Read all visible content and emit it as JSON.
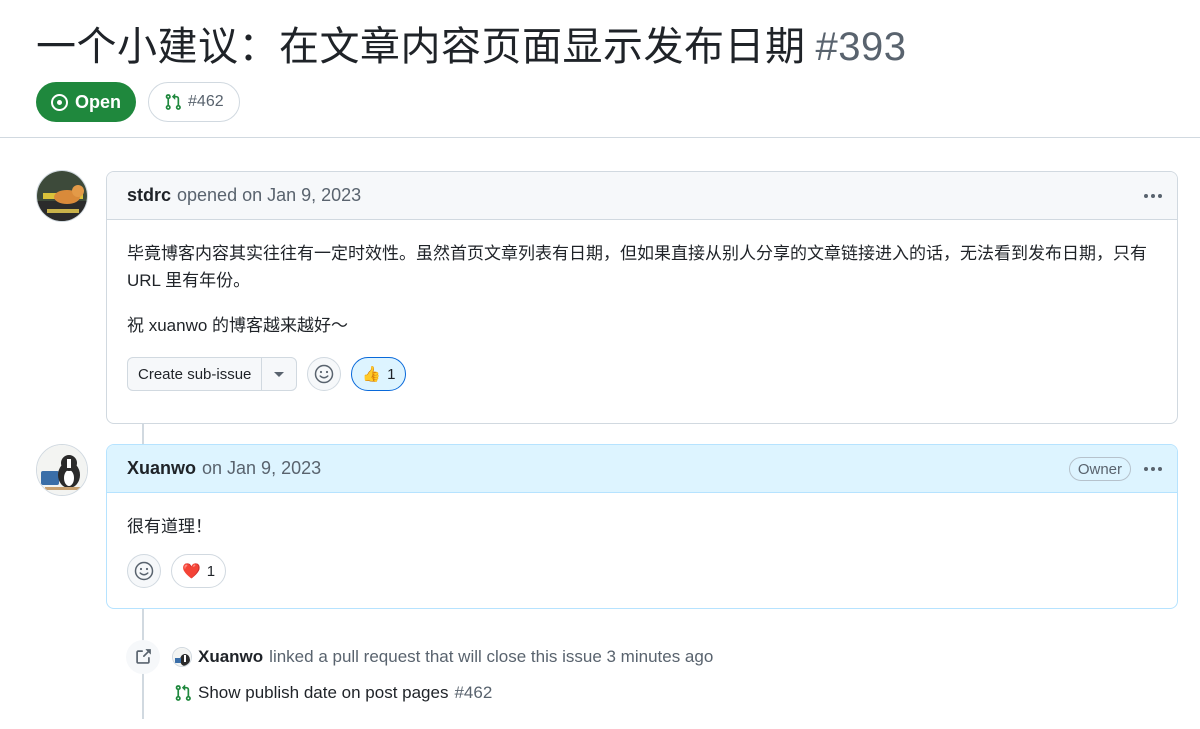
{
  "issue": {
    "title": "一个小建议：在文章内容页面显示发布日期",
    "number": "#393",
    "state": "Open",
    "linked_pr_chip": "#462"
  },
  "comments": [
    {
      "author": "stdrc",
      "meta": "opened on Jan 9, 2023",
      "body": [
        "毕竟博客内容其实往往有一定时效性。虽然首页文章列表有日期，但如果直接从别人分享的文章链接进入的话，无法看到发布日期，只有 URL 里有年份。",
        "祝 xuanwo 的博客越来越好～"
      ],
      "create_sub_issue_label": "Create sub-issue",
      "reaction": {
        "emoji": "👍",
        "count": "1"
      }
    },
    {
      "author": "Xuanwo",
      "meta": "on Jan 9, 2023",
      "role_badge": "Owner",
      "body": [
        "很有道理！"
      ],
      "reaction": {
        "emoji": "❤️",
        "count": "1"
      }
    }
  ],
  "event": {
    "author": "Xuanwo",
    "text": "linked a pull request that will close this issue 3 minutes ago",
    "pr_title": "Show publish date on post pages",
    "pr_number": "#462"
  },
  "colors": {
    "open_green": "#1f883d",
    "owner_header_bg": "#ddf4ff",
    "accent_blue": "#0969da"
  }
}
